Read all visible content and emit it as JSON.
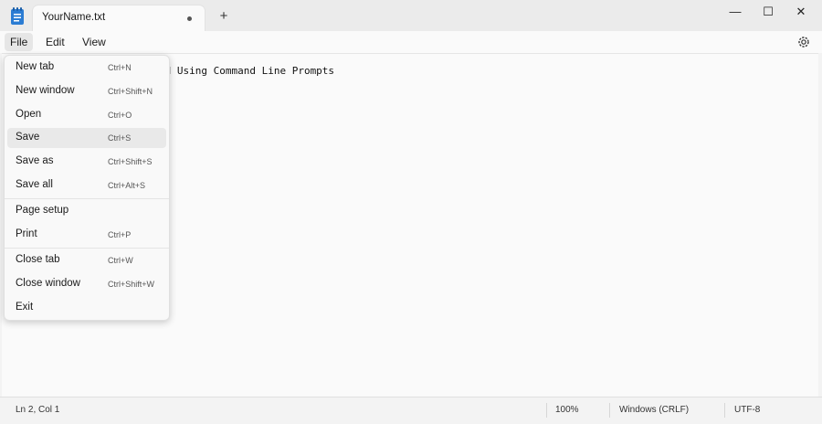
{
  "window": {
    "tab_title": "YourName.txt",
    "new_tab_icon": "+",
    "minimize_icon": "—",
    "maximize_icon": "☐",
    "close_icon": "✕"
  },
  "menubar": {
    "file": "File",
    "edit": "Edit",
    "view": "View"
  },
  "editor": {
    "visible_text": "ed Using Command Line Prompts"
  },
  "file_menu": {
    "items": [
      {
        "label": "New tab",
        "shortcut": "Ctrl+N"
      },
      {
        "label": "New window",
        "shortcut": "Ctrl+Shift+N"
      },
      {
        "label": "Open",
        "shortcut": "Ctrl+O"
      },
      {
        "label": "Save",
        "shortcut": "Ctrl+S"
      },
      {
        "label": "Save as",
        "shortcut": "Ctrl+Shift+S"
      },
      {
        "label": "Save all",
        "shortcut": "Ctrl+Alt+S"
      },
      {
        "label": "Page setup",
        "shortcut": ""
      },
      {
        "label": "Print",
        "shortcut": "Ctrl+P"
      },
      {
        "label": "Close tab",
        "shortcut": "Ctrl+W"
      },
      {
        "label": "Close window",
        "shortcut": "Ctrl+Shift+W"
      },
      {
        "label": "Exit",
        "shortcut": ""
      }
    ]
  },
  "statusbar": {
    "position": "Ln 2, Col 1",
    "zoom": "100%",
    "line_ending": "Windows (CRLF)",
    "encoding": "UTF-8"
  }
}
